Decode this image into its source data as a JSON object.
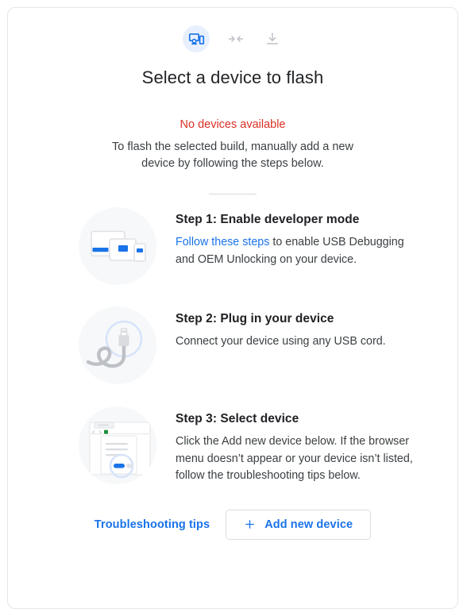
{
  "header": {
    "icons": [
      {
        "name": "devices-icon",
        "active": true
      },
      {
        "name": "merge-arrows-icon",
        "active": false
      },
      {
        "name": "download-icon",
        "active": false
      }
    ],
    "title": "Select a device to flash"
  },
  "status": {
    "error": "No devices available",
    "description": "To flash the selected build, manually add a new device by following the steps below."
  },
  "steps": [
    {
      "title": "Step 1: Enable developer mode",
      "link_text": "Follow these steps",
      "text": " to enable USB Debugging and OEM Unlocking on your device.",
      "art": "devices-illustration"
    },
    {
      "title": "Step 2: Plug in your device",
      "link_text": "",
      "text": "Connect your device using any USB cord.",
      "art": "usb-cable-illustration"
    },
    {
      "title": "Step 3: Select device",
      "link_text": "",
      "text": "Click the Add new device below. If the browser menu doesn’t appear or your device isn’t listed, follow the troubleshooting tips below.",
      "art": "browser-picker-illustration"
    }
  ],
  "footer": {
    "troubleshooting_label": "Troubleshooting tips",
    "add_device_label": "Add new device",
    "add_icon": "plus-icon"
  },
  "colors": {
    "accent_blue": "#1a73e8",
    "error_red": "#d93025",
    "icon_bg": "#e8f0fe",
    "art_bg": "#f6f8fa",
    "text_primary": "#202124",
    "text_secondary": "#3c4043",
    "border": "#dadce0"
  }
}
